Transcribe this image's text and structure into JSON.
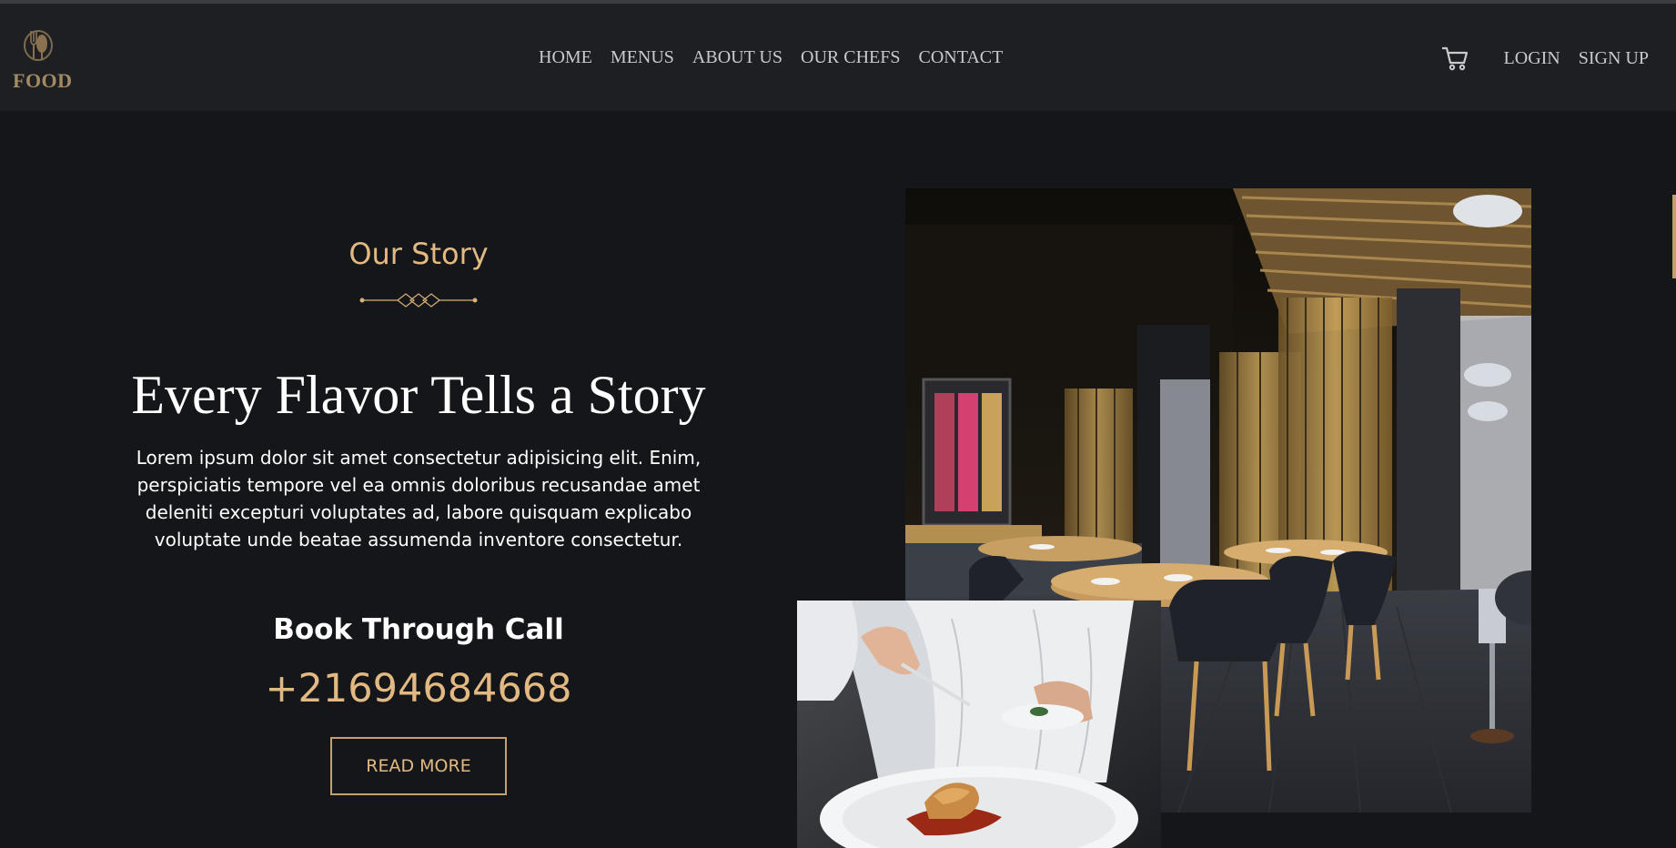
{
  "brand": {
    "name": "FOOD",
    "icon": "fork-spoon-icon"
  },
  "nav": {
    "links": [
      "HOME",
      "MENUS",
      "ABOUT US",
      "OUR CHEFS",
      "CONTACT"
    ],
    "cart_icon": "shopping-cart-icon",
    "login": "LOGIN",
    "signup": "SIGN UP"
  },
  "story": {
    "eyebrow": "Our Story",
    "headline": "Every Flavor Tells a Story",
    "body": "Lorem ipsum dolor sit amet consectetur adipisicing elit. Enim, perspiciatis tempore vel ea omnis doloribus recusandae amet deleniti excepturi voluptates ad, labore quisquam explicabo voluptate unde beatae assumenda inventore consectetur.",
    "call_title": "Book Through Call",
    "phone": "+21694684668",
    "button": "READ MORE"
  },
  "images": {
    "main": "restaurant-interior-photo",
    "secondary": "chef-plating-photo"
  },
  "colors": {
    "background": "#151619",
    "navbar": "#1e1f23",
    "accent": "#e2b982",
    "brand": "#a28a63"
  }
}
